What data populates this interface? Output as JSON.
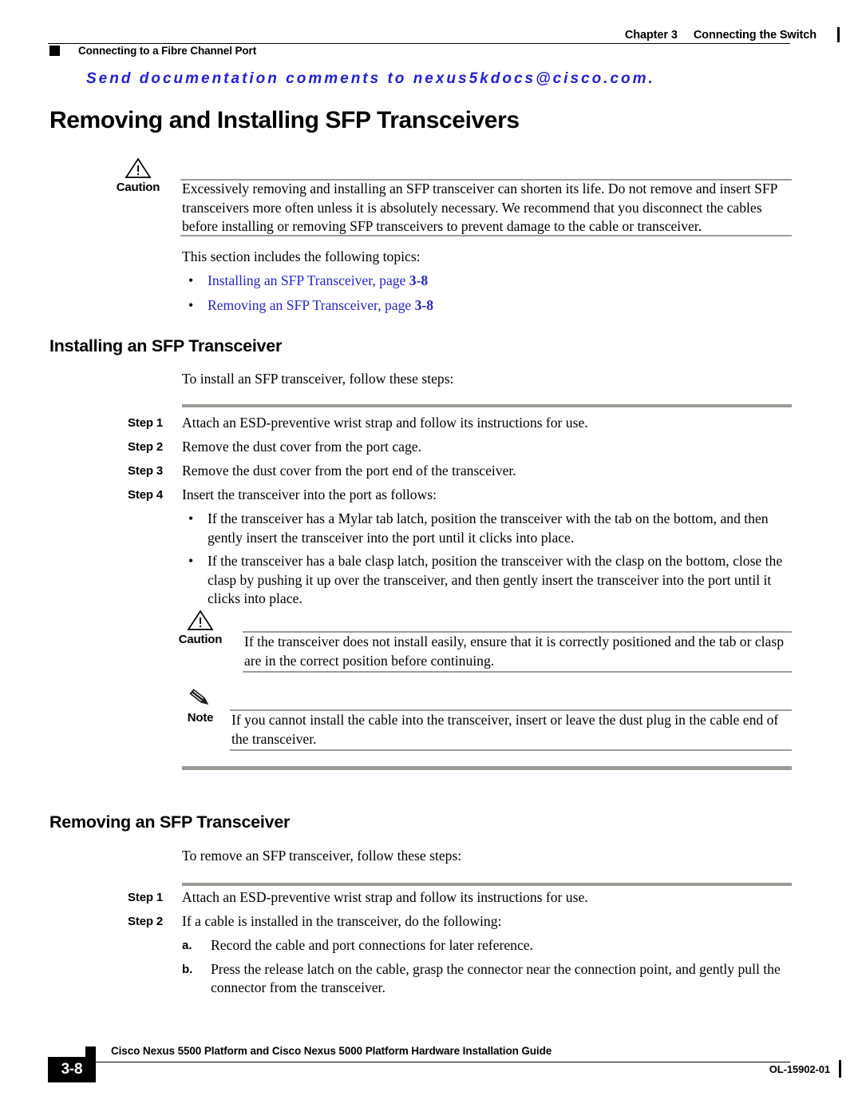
{
  "header": {
    "chapter_label": "Chapter 3",
    "chapter_title": "Connecting the Switch",
    "running_section": "Connecting to a Fibre Channel Port"
  },
  "banner": {
    "text": "Send documentation comments to nexus5kdocs@cisco.com."
  },
  "title": "Removing and Installing SFP Transceivers",
  "caution_intro": {
    "label": "Caution",
    "text": "Excessively removing and installing an SFP transceiver can shorten its life. Do not remove and insert SFP transceivers more often unless it is absolutely necessary. We recommend that you disconnect the cables before installing or removing SFP transceivers to prevent damage to the cable or transceiver."
  },
  "section_intro": "This section includes the following topics:",
  "topic_links": [
    {
      "text": "Installing an SFP Transceiver, page ",
      "page": "3-8"
    },
    {
      "text": "Removing an SFP Transceiver, page ",
      "page": "3-8"
    }
  ],
  "installing": {
    "heading": "Installing an SFP Transceiver",
    "lead_in": "To install an SFP transceiver, follow these steps:",
    "steps": [
      {
        "label": "Step 1",
        "text": "Attach an ESD-preventive wrist strap and follow its instructions for use."
      },
      {
        "label": "Step 2",
        "text": "Remove the dust cover from the port cage."
      },
      {
        "label": "Step 3",
        "text": "Remove the dust cover from the port end of the transceiver."
      },
      {
        "label": "Step 4",
        "text": "Insert the transceiver into the port as follows:"
      }
    ],
    "step4_bullets": [
      "If the transceiver has a Mylar tab latch, position the transceiver with the tab on the bottom, and then gently insert the transceiver into the port until it clicks into place.",
      "If the transceiver has a bale clasp latch, position the transceiver with the clasp on the bottom, close the clasp by pushing it up over the transceiver, and then gently insert the transceiver into the port until it clicks into place."
    ],
    "caution": {
      "label": "Caution",
      "text": "If the transceiver does not install easily, ensure that it is correctly positioned and the tab or clasp are in the correct position before continuing."
    },
    "note": {
      "label": "Note",
      "text": "If you cannot install the cable into the transceiver, insert or leave the dust plug in the cable end of the transceiver."
    }
  },
  "removing": {
    "heading": "Removing an SFP Transceiver",
    "lead_in": "To remove an SFP transceiver, follow these steps:",
    "steps": [
      {
        "label": "Step 1",
        "text": "Attach an ESD-preventive wrist strap and follow its instructions for use."
      },
      {
        "label": "Step 2",
        "text": "If a cable is installed in the transceiver, do the following:"
      }
    ],
    "step2_items": [
      {
        "marker": "a.",
        "text": "Record the cable and port connections for later reference."
      },
      {
        "marker": "b.",
        "text": "Press the release latch on the cable, grasp the connector near the connection point, and gently pull the connector from the transceiver."
      }
    ]
  },
  "footer": {
    "page_number": "3-8",
    "guide_title": "Cisco Nexus 5500 Platform and Cisco Nexus 5000 Platform Hardware Installation Guide",
    "doc_id": "OL-15902-01"
  },
  "colors": {
    "link_blue": "#2424d0",
    "banner_blue": "#2020d8",
    "rule_gray": "#9d9d97"
  }
}
